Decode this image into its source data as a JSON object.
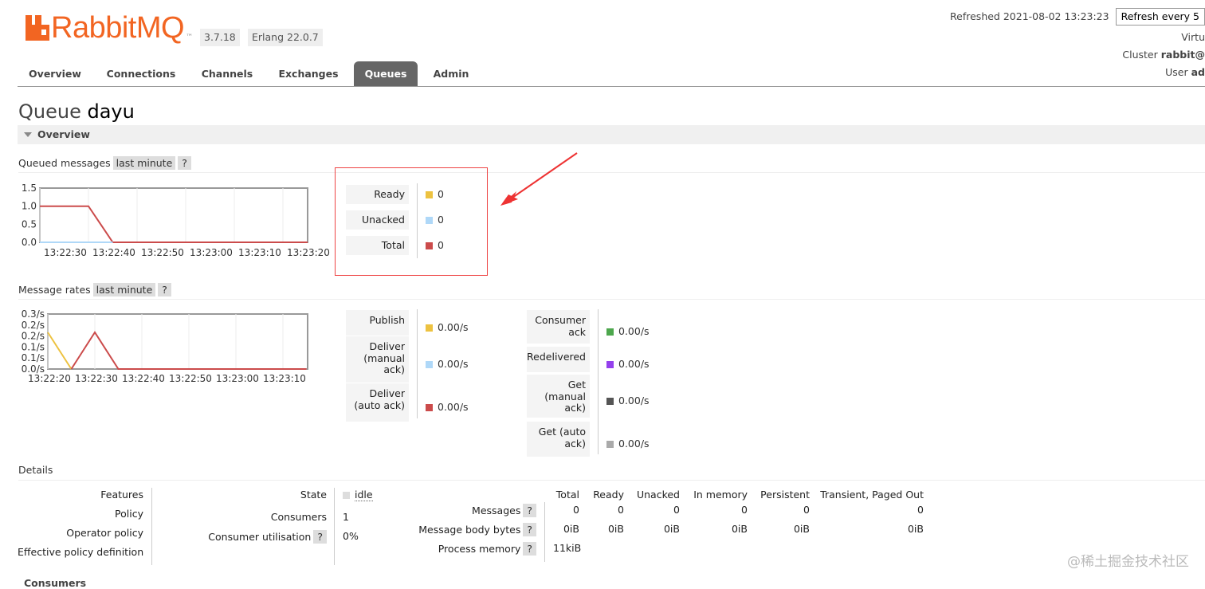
{
  "header": {
    "brand": "RabbitMQ",
    "trademark": "™",
    "version": "3.7.18",
    "erlang": "Erlang 22.0.7",
    "refreshed_label": "Refreshed 2021-08-02 13:23:23",
    "refresh_select": "Refresh every 5",
    "virtual_host": "Virtu",
    "cluster_label": "Cluster",
    "cluster_value": "rabbit@",
    "user_label": "User",
    "user_value": "ad"
  },
  "nav": {
    "tabs": [
      "Overview",
      "Connections",
      "Channels",
      "Exchanges",
      "Queues",
      "Admin"
    ],
    "active": "Queues"
  },
  "page": {
    "title_prefix": "Queue",
    "title_name": "dayu",
    "overview_section": "Overview"
  },
  "queued": {
    "heading": "Queued messages",
    "range": "last minute",
    "help": "?",
    "legend": [
      {
        "label": "Ready",
        "value": "0",
        "color": "#edc240"
      },
      {
        "label": "Unacked",
        "value": "0",
        "color": "#afd8f8"
      },
      {
        "label": "Total",
        "value": "0",
        "color": "#cb4b4b"
      }
    ]
  },
  "rates": {
    "heading": "Message rates",
    "range": "last minute",
    "help": "?",
    "left": [
      {
        "label": "Publish",
        "value": "0.00/s",
        "color": "#edc240"
      },
      {
        "label": "Deliver (manual ack)",
        "value": "0.00/s",
        "color": "#afd8f8"
      },
      {
        "label": "Deliver (auto ack)",
        "value": "0.00/s",
        "color": "#cb4b4b"
      }
    ],
    "right": [
      {
        "label": "Consumer ack",
        "value": "0.00/s",
        "color": "#4da74d"
      },
      {
        "label": "Redelivered",
        "value": "0.00/s",
        "color": "#9440ed"
      },
      {
        "label": "Get (manual ack)",
        "value": "0.00/s",
        "color": "#555555"
      },
      {
        "label": "Get (auto ack)",
        "value": "0.00/s",
        "color": "#aaaaaa"
      }
    ]
  },
  "chart_data": [
    {
      "type": "line",
      "x": [
        "13:22:30",
        "13:22:40",
        "13:22:50",
        "13:23:00",
        "13:23:10",
        "13:23:20"
      ],
      "yticks": [
        "1.5",
        "1.0",
        "0.5",
        "0.0"
      ],
      "ylim": [
        0,
        1.5
      ],
      "series": [
        {
          "color": "#cb4b4b",
          "points": [
            [
              0,
              1.0
            ],
            [
              1,
              1.0
            ],
            [
              1.5,
              0
            ],
            [
              6,
              0
            ]
          ]
        },
        {
          "color": "#afd8f8",
          "points": [
            [
              0,
              0
            ],
            [
              1.5,
              0
            ]
          ]
        }
      ]
    },
    {
      "type": "line",
      "x": [
        "13:22:20",
        "13:22:30",
        "13:22:40",
        "13:22:50",
        "13:23:00",
        "13:23:10"
      ],
      "yticks": [
        "0.3/s",
        "0.2/s",
        "0.2/s",
        "0.1/s",
        "0.1/s",
        "0.0/s"
      ],
      "ylim": [
        0,
        0.3
      ],
      "series": [
        {
          "color": "#edc240",
          "points": [
            [
              0,
              0.2
            ],
            [
              0.5,
              0
            ]
          ]
        },
        {
          "color": "#cb4b4b",
          "points": [
            [
              0.5,
              0
            ],
            [
              1,
              0.2
            ],
            [
              1.5,
              0
            ],
            [
              5.5,
              0
            ]
          ]
        }
      ]
    }
  ],
  "details": {
    "heading": "Details",
    "features_labels": [
      "Features",
      "Policy",
      "Operator policy",
      "Effective policy definition"
    ],
    "state_label": "State",
    "state_value": "idle",
    "consumers_label": "Consumers",
    "consumers_value": "1",
    "utilisation_label": "Consumer utilisation",
    "utilisation_value": "0%",
    "help": "?",
    "columns": [
      "Total",
      "Ready",
      "Unacked",
      "In memory",
      "Persistent",
      "Transient, Paged Out"
    ],
    "rows": [
      {
        "label": "Messages",
        "values": [
          "0",
          "0",
          "0",
          "0",
          "0",
          "0"
        ]
      },
      {
        "label": "Message body bytes",
        "values": [
          "0iB",
          "0iB",
          "0iB",
          "0iB",
          "0iB",
          "0iB"
        ]
      },
      {
        "label": "Process memory",
        "values": [
          "11kiB"
        ]
      }
    ]
  },
  "footer": {
    "consumers_section": "Consumers",
    "watermark": "@稀土掘金技术社区"
  }
}
